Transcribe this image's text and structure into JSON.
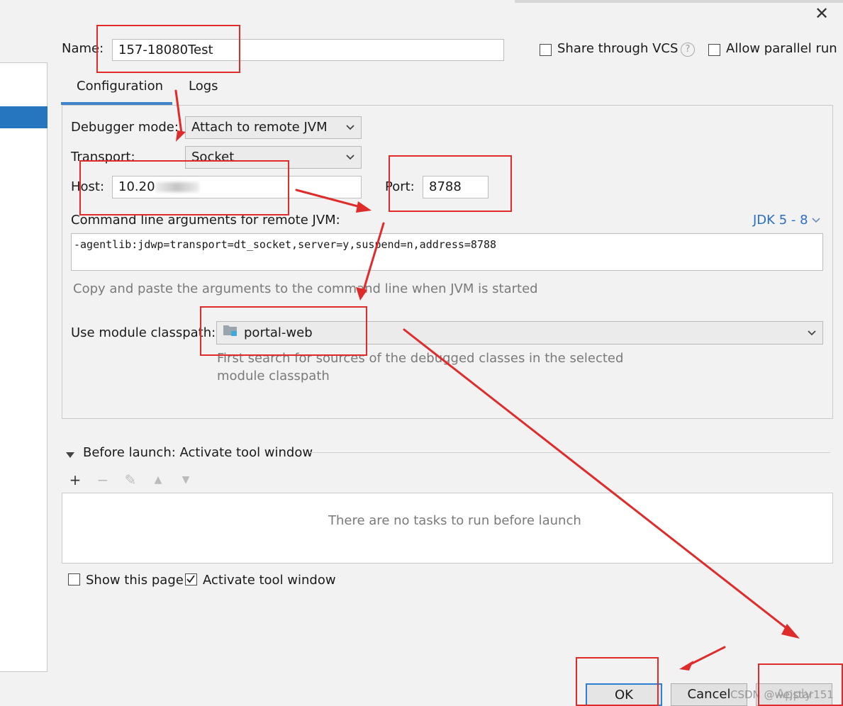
{
  "dialog": {
    "close_glyph": "✕"
  },
  "name_row": {
    "label": "Name:",
    "value": "157-18080Test",
    "share_vcs_label": "Share through VCS",
    "help_glyph": "?",
    "parallel_run_label": "Allow parallel run"
  },
  "tabs": [
    {
      "label": "Configuration",
      "active": true
    },
    {
      "label": "Logs",
      "active": false
    }
  ],
  "config": {
    "debugger_mode_label": "Debugger mode:",
    "debugger_mode_value": "Attach to remote JVM",
    "transport_label": "Transport:",
    "transport_value": "Socket",
    "host_label": "Host:",
    "host_value": "10.20",
    "port_label": "Port:",
    "port_value": "8788",
    "cmd_label": "Command line arguments for remote JVM:",
    "jdk_label": "JDK 5 - 8",
    "cmd_value": "-agentlib:jdwp=transport=dt_socket,server=y,suspend=n,address=8788",
    "cmd_hint": "Copy and paste the arguments to the command line when JVM is started",
    "module_label": "Use module classpath:",
    "module_value": "portal-web",
    "module_hint_line1": "First search for sources of the debugged classes in the selected",
    "module_hint_line2": "module classpath"
  },
  "before_launch": {
    "title": "Before launch: Activate tool window",
    "tools": [
      {
        "glyph": "+",
        "enabled": true
      },
      {
        "glyph": "−",
        "enabled": false
      },
      {
        "glyph": "✎",
        "enabled": false
      },
      {
        "glyph": "▲",
        "enabled": false
      },
      {
        "glyph": "▼",
        "enabled": false
      }
    ],
    "empty_text": "There are no tasks to run before launch"
  },
  "options": {
    "show_page_label": "Show this page",
    "show_page_checked": false,
    "activate_tool_label": "Activate tool window",
    "activate_tool_checked": true,
    "share_vcs_checked": false,
    "parallel_run_checked": false
  },
  "buttons": {
    "ok": "OK",
    "cancel": "Cancel",
    "apply": "Apply"
  },
  "watermark": "CSDN @wejstar151",
  "colors": {
    "accent": "#2675bf",
    "annotation_red": "#e02b2b",
    "link": "#2b6fc4"
  }
}
